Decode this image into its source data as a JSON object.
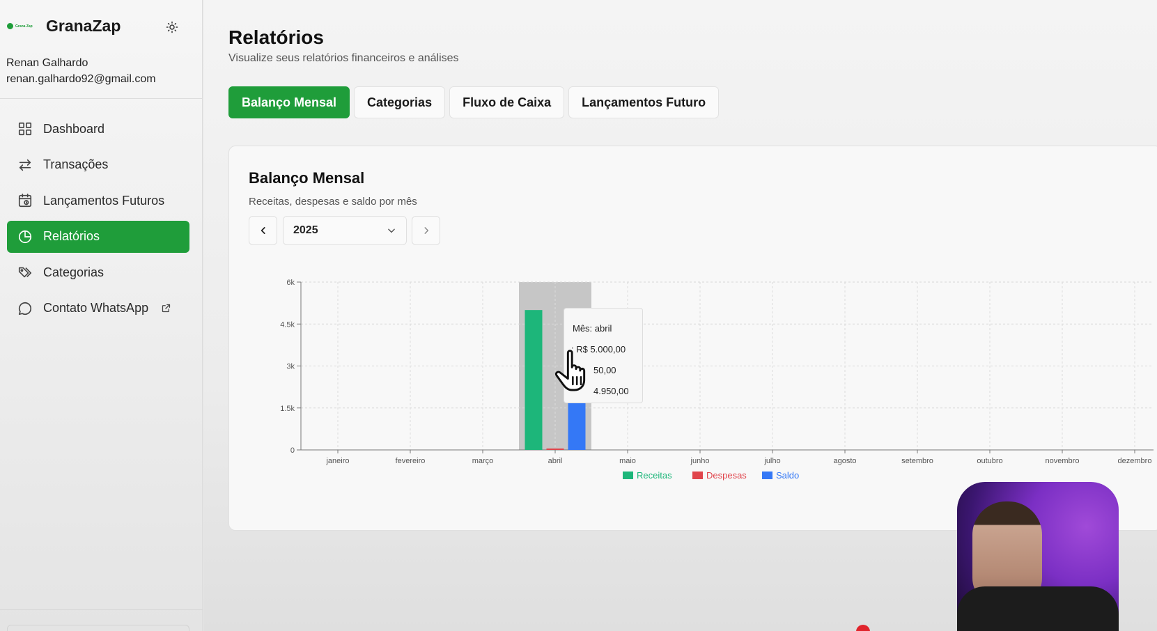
{
  "app": {
    "logo_text": "Grana Zap",
    "name": "GranaZap"
  },
  "user": {
    "name": "Renan Galhardo",
    "email": "renan.galhardo92@gmail.com"
  },
  "sidebar": {
    "items": [
      {
        "label": "Dashboard",
        "icon": "grid-icon"
      },
      {
        "label": "Transações",
        "icon": "arrows-icon"
      },
      {
        "label": "Lançamentos Futuros",
        "icon": "calendar-clock-icon"
      },
      {
        "label": "Relatórios",
        "icon": "pie-chart-icon",
        "active": true
      },
      {
        "label": "Categorias",
        "icon": "tags-icon"
      },
      {
        "label": "Contato WhatsApp",
        "icon": "chat-icon",
        "external": true
      }
    ]
  },
  "page": {
    "title": "Relatórios",
    "subtitle": "Visualize seus relatórios financeiros e análises",
    "tabs": [
      "Balanço Mensal",
      "Categorias",
      "Fluxo de Caixa",
      "Lançamentos Futuro"
    ],
    "active_tab": 0
  },
  "card": {
    "title": "Balanço Mensal",
    "subtitle": "Receitas, despesas e saldo por mês",
    "year": "2025"
  },
  "tooltip": {
    "month": "Mês: abril",
    "receitas": ": R$ 5.000,00",
    "despesas": "50,00",
    "saldo": "4.950,00"
  },
  "colors": {
    "brand": "#1f9d3a",
    "receitas": "#1db67a",
    "despesas": "#e0444b",
    "saldo": "#3478f6"
  },
  "chart_data": {
    "type": "bar",
    "categories": [
      "janeiro",
      "fevereiro",
      "março",
      "abril",
      "maio",
      "junho",
      "julho",
      "agosto",
      "setembro",
      "outubro",
      "novembro",
      "dezembro"
    ],
    "series": [
      {
        "name": "Receitas",
        "values": [
          0,
          0,
          0,
          5000,
          0,
          0,
          0,
          0,
          0,
          0,
          0,
          0
        ]
      },
      {
        "name": "Despesas",
        "values": [
          0,
          0,
          0,
          50,
          0,
          0,
          0,
          0,
          0,
          0,
          0,
          0
        ]
      },
      {
        "name": "Saldo",
        "values": [
          0,
          0,
          0,
          4950,
          0,
          0,
          0,
          0,
          0,
          0,
          0,
          0
        ]
      }
    ],
    "yticks": [
      "0",
      "1.5k",
      "3k",
      "4.5k",
      "6k"
    ],
    "ylim": [
      0,
      6000
    ],
    "highlight_category": "abril",
    "grid": true,
    "legend_position": "bottom"
  }
}
